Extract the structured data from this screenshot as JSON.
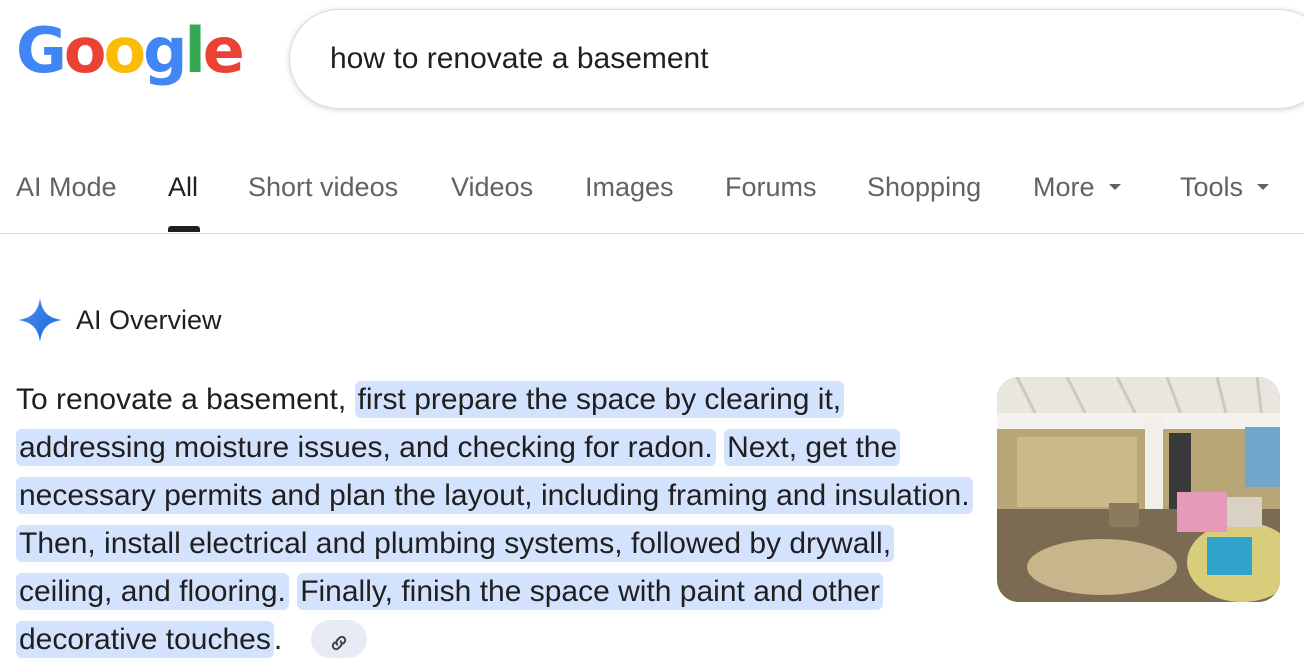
{
  "logo": {
    "letters": [
      "G",
      "o",
      "o",
      "g",
      "l",
      "e"
    ],
    "colors": [
      "#4285F4",
      "#EA4335",
      "#FBBC05",
      "#4285F4",
      "#34A853",
      "#EA4335"
    ]
  },
  "search": {
    "query": "how to renovate a basement"
  },
  "tabs": [
    {
      "label": "AI Mode"
    },
    {
      "label": "All"
    },
    {
      "label": "Short videos"
    },
    {
      "label": "Videos"
    },
    {
      "label": "Images"
    },
    {
      "label": "Forums"
    },
    {
      "label": "Shopping"
    },
    {
      "label": "More"
    },
    {
      "label": "Tools"
    }
  ],
  "ai_overview": {
    "title": "AI Overview",
    "icon": "gemini-sparkle-icon",
    "intro": "To renovate a basement,",
    "segments": [
      "first prepare the space by clearing it, addressing moisture issues, and checking for radon.",
      "Next, get the necessary permits and plan the layout, including framing and insulation.",
      "Then, install electrical and plumbing systems, followed by drywall, ceiling, and flooring.",
      "Finally, finish the space with paint and other decorative touches"
    ],
    "ending": ".",
    "link_icon": "link-icon",
    "image": "basement-photo"
  },
  "colors": {
    "highlight": "#d3e3fd",
    "accent": "#1a73e8",
    "tab_text": "#5f6368"
  }
}
